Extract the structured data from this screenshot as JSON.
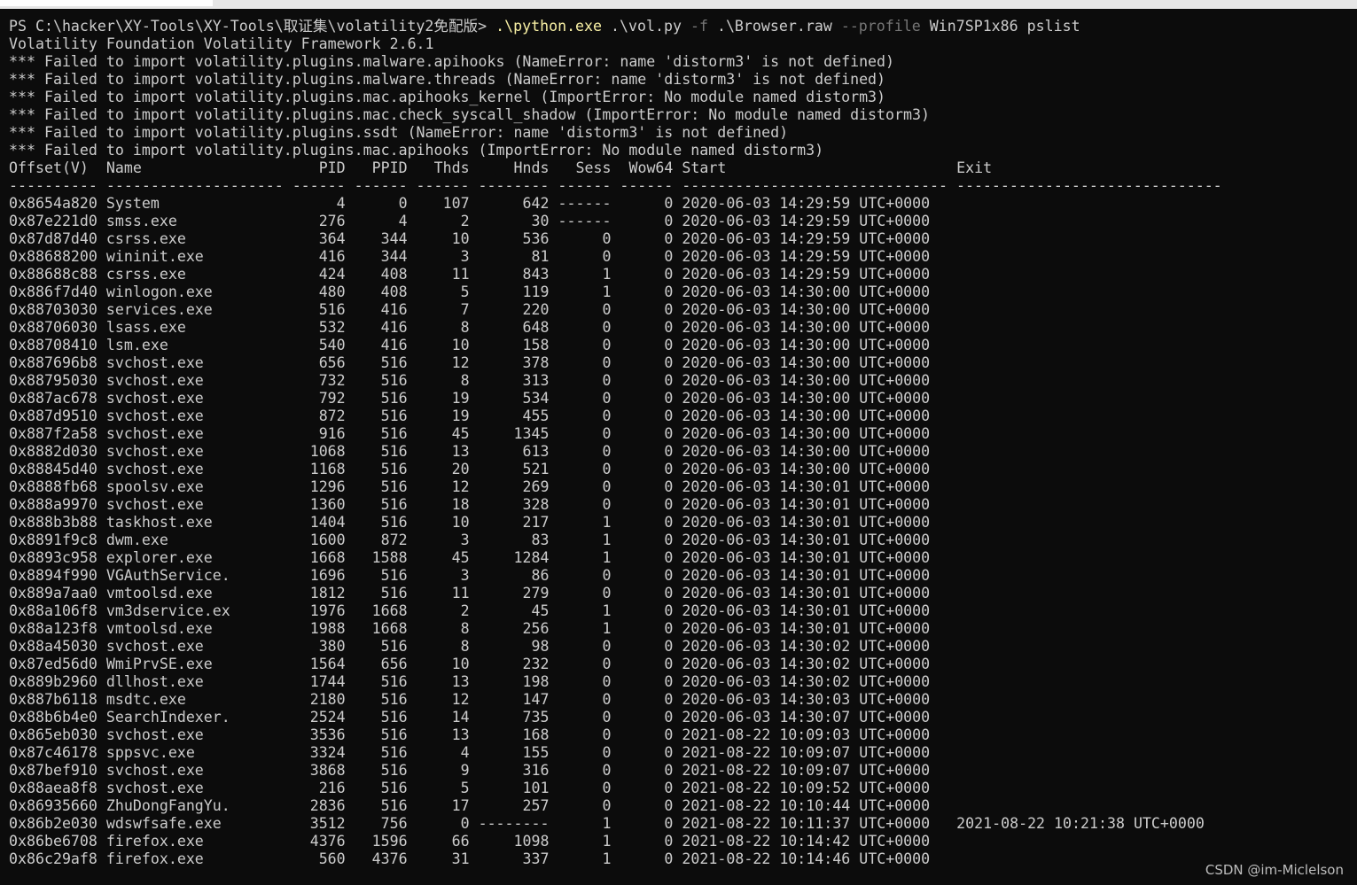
{
  "terminal": {
    "prompt": "PS C:\\hacker\\XY-Tools\\XY-Tools\\取证集\\volatility2免配版>",
    "command": [
      {
        "t": ".\\python.exe",
        "k": "exe"
      },
      {
        "t": ".\\vol.py",
        "k": "arg"
      },
      {
        "t": "-f",
        "k": "flag"
      },
      {
        "t": ".\\Browser.raw",
        "k": "arg"
      },
      {
        "t": "--profile",
        "k": "flag"
      },
      {
        "t": "Win7SP1x86",
        "k": "arg"
      },
      {
        "t": "pslist",
        "k": "arg"
      }
    ],
    "banner": "Volatility Foundation Volatility Framework 2.6.1",
    "errors": [
      "*** Failed to import volatility.plugins.malware.apihooks (NameError: name 'distorm3' is not defined)",
      "*** Failed to import volatility.plugins.malware.threads (NameError: name 'distorm3' is not defined)",
      "*** Failed to import volatility.plugins.mac.apihooks_kernel (ImportError: No module named distorm3)",
      "*** Failed to import volatility.plugins.mac.check_syscall_shadow (ImportError: No module named distorm3)",
      "*** Failed to import volatility.plugins.ssdt (NameError: name 'distorm3' is not defined)",
      "*** Failed to import volatility.plugins.mac.apihooks (ImportError: No module named distorm3)"
    ],
    "columns": [
      "Offset(V)",
      "Name",
      "PID",
      "PPID",
      "Thds",
      "Hnds",
      "Sess",
      "Wow64",
      "Start",
      "Exit"
    ],
    "column_widths": [
      10,
      20,
      6,
      6,
      6,
      8,
      6,
      6,
      30,
      30
    ],
    "column_align": [
      "l",
      "l",
      "r",
      "r",
      "r",
      "r",
      "r",
      "r",
      "l",
      "l"
    ],
    "rows": [
      [
        "0x8654a820",
        "System",
        "4",
        "0",
        "107",
        "642",
        "------",
        "0",
        "2020-06-03 14:29:59 UTC+0000",
        ""
      ],
      [
        "0x87e221d0",
        "smss.exe",
        "276",
        "4",
        "2",
        "30",
        "------",
        "0",
        "2020-06-03 14:29:59 UTC+0000",
        ""
      ],
      [
        "0x87d87d40",
        "csrss.exe",
        "364",
        "344",
        "10",
        "536",
        "0",
        "0",
        "2020-06-03 14:29:59 UTC+0000",
        ""
      ],
      [
        "0x88688200",
        "wininit.exe",
        "416",
        "344",
        "3",
        "81",
        "0",
        "0",
        "2020-06-03 14:29:59 UTC+0000",
        ""
      ],
      [
        "0x88688c88",
        "csrss.exe",
        "424",
        "408",
        "11",
        "843",
        "1",
        "0",
        "2020-06-03 14:29:59 UTC+0000",
        ""
      ],
      [
        "0x886f7d40",
        "winlogon.exe",
        "480",
        "408",
        "5",
        "119",
        "1",
        "0",
        "2020-06-03 14:30:00 UTC+0000",
        ""
      ],
      [
        "0x88703030",
        "services.exe",
        "516",
        "416",
        "7",
        "220",
        "0",
        "0",
        "2020-06-03 14:30:00 UTC+0000",
        ""
      ],
      [
        "0x88706030",
        "lsass.exe",
        "532",
        "416",
        "8",
        "648",
        "0",
        "0",
        "2020-06-03 14:30:00 UTC+0000",
        ""
      ],
      [
        "0x88708410",
        "lsm.exe",
        "540",
        "416",
        "10",
        "158",
        "0",
        "0",
        "2020-06-03 14:30:00 UTC+0000",
        ""
      ],
      [
        "0x887696b8",
        "svchost.exe",
        "656",
        "516",
        "12",
        "378",
        "0",
        "0",
        "2020-06-03 14:30:00 UTC+0000",
        ""
      ],
      [
        "0x88795030",
        "svchost.exe",
        "732",
        "516",
        "8",
        "313",
        "0",
        "0",
        "2020-06-03 14:30:00 UTC+0000",
        ""
      ],
      [
        "0x887ac678",
        "svchost.exe",
        "792",
        "516",
        "19",
        "534",
        "0",
        "0",
        "2020-06-03 14:30:00 UTC+0000",
        ""
      ],
      [
        "0x887d9510",
        "svchost.exe",
        "872",
        "516",
        "19",
        "455",
        "0",
        "0",
        "2020-06-03 14:30:00 UTC+0000",
        ""
      ],
      [
        "0x887f2a58",
        "svchost.exe",
        "916",
        "516",
        "45",
        "1345",
        "0",
        "0",
        "2020-06-03 14:30:00 UTC+0000",
        ""
      ],
      [
        "0x8882d030",
        "svchost.exe",
        "1068",
        "516",
        "13",
        "613",
        "0",
        "0",
        "2020-06-03 14:30:00 UTC+0000",
        ""
      ],
      [
        "0x88845d40",
        "svchost.exe",
        "1168",
        "516",
        "20",
        "521",
        "0",
        "0",
        "2020-06-03 14:30:00 UTC+0000",
        ""
      ],
      [
        "0x8888fb68",
        "spoolsv.exe",
        "1296",
        "516",
        "12",
        "269",
        "0",
        "0",
        "2020-06-03 14:30:01 UTC+0000",
        ""
      ],
      [
        "0x888a9970",
        "svchost.exe",
        "1360",
        "516",
        "18",
        "328",
        "0",
        "0",
        "2020-06-03 14:30:01 UTC+0000",
        ""
      ],
      [
        "0x888b3b88",
        "taskhost.exe",
        "1404",
        "516",
        "10",
        "217",
        "1",
        "0",
        "2020-06-03 14:30:01 UTC+0000",
        ""
      ],
      [
        "0x8891f9c8",
        "dwm.exe",
        "1600",
        "872",
        "3",
        "83",
        "1",
        "0",
        "2020-06-03 14:30:01 UTC+0000",
        ""
      ],
      [
        "0x8893c958",
        "explorer.exe",
        "1668",
        "1588",
        "45",
        "1284",
        "1",
        "0",
        "2020-06-03 14:30:01 UTC+0000",
        ""
      ],
      [
        "0x8894f990",
        "VGAuthService.",
        "1696",
        "516",
        "3",
        "86",
        "0",
        "0",
        "2020-06-03 14:30:01 UTC+0000",
        ""
      ],
      [
        "0x889a7aa0",
        "vmtoolsd.exe",
        "1812",
        "516",
        "11",
        "279",
        "0",
        "0",
        "2020-06-03 14:30:01 UTC+0000",
        ""
      ],
      [
        "0x88a106f8",
        "vm3dservice.ex",
        "1976",
        "1668",
        "2",
        "45",
        "1",
        "0",
        "2020-06-03 14:30:01 UTC+0000",
        ""
      ],
      [
        "0x88a123f8",
        "vmtoolsd.exe",
        "1988",
        "1668",
        "8",
        "256",
        "1",
        "0",
        "2020-06-03 14:30:01 UTC+0000",
        ""
      ],
      [
        "0x88a45030",
        "svchost.exe",
        "380",
        "516",
        "8",
        "98",
        "0",
        "0",
        "2020-06-03 14:30:02 UTC+0000",
        ""
      ],
      [
        "0x87ed56d0",
        "WmiPrvSE.exe",
        "1564",
        "656",
        "10",
        "232",
        "0",
        "0",
        "2020-06-03 14:30:02 UTC+0000",
        ""
      ],
      [
        "0x889b2960",
        "dllhost.exe",
        "1744",
        "516",
        "13",
        "198",
        "0",
        "0",
        "2020-06-03 14:30:02 UTC+0000",
        ""
      ],
      [
        "0x887b6118",
        "msdtc.exe",
        "2180",
        "516",
        "12",
        "147",
        "0",
        "0",
        "2020-06-03 14:30:03 UTC+0000",
        ""
      ],
      [
        "0x88b6b4e0",
        "SearchIndexer.",
        "2524",
        "516",
        "14",
        "735",
        "0",
        "0",
        "2020-06-03 14:30:07 UTC+0000",
        ""
      ],
      [
        "0x865eb030",
        "svchost.exe",
        "3536",
        "516",
        "13",
        "168",
        "0",
        "0",
        "2021-08-22 10:09:03 UTC+0000",
        ""
      ],
      [
        "0x87c46178",
        "sppsvc.exe",
        "3324",
        "516",
        "4",
        "155",
        "0",
        "0",
        "2021-08-22 10:09:07 UTC+0000",
        ""
      ],
      [
        "0x87bef910",
        "svchost.exe",
        "3868",
        "516",
        "9",
        "316",
        "0",
        "0",
        "2021-08-22 10:09:07 UTC+0000",
        ""
      ],
      [
        "0x88aea8f8",
        "svchost.exe",
        "216",
        "516",
        "5",
        "101",
        "0",
        "0",
        "2021-08-22 10:09:52 UTC+0000",
        ""
      ],
      [
        "0x86935660",
        "ZhuDongFangYu.",
        "2836",
        "516",
        "17",
        "257",
        "0",
        "0",
        "2021-08-22 10:10:44 UTC+0000",
        ""
      ],
      [
        "0x86b2e030",
        "wdswfsafe.exe",
        "3512",
        "756",
        "0",
        "--------",
        "1",
        "0",
        "2021-08-22 10:11:37 UTC+0000",
        "2021-08-22 10:21:38 UTC+0000"
      ],
      [
        "0x86be6708",
        "firefox.exe",
        "4376",
        "1596",
        "66",
        "1098",
        "1",
        "0",
        "2021-08-22 10:14:42 UTC+0000",
        ""
      ],
      [
        "0x86c29af8",
        "firefox.exe",
        "560",
        "4376",
        "31",
        "337",
        "1",
        "0",
        "2021-08-22 10:14:46 UTC+0000",
        ""
      ]
    ]
  },
  "watermark": "CSDN @im-Miclelson",
  "colors": {
    "background": "#0c0c0c",
    "text": "#cccccc",
    "command_exe": "#f9f1a5",
    "command_flag": "#767676"
  }
}
